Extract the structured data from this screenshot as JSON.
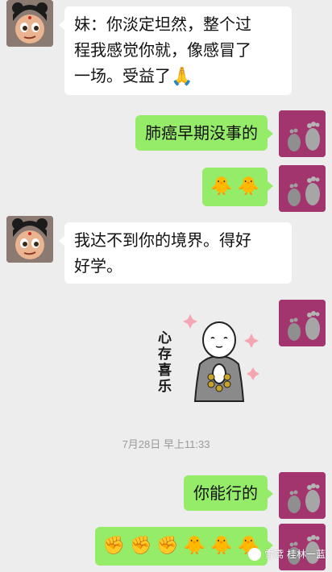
{
  "messages": [
    {
      "id": 1,
      "side": "in",
      "text_line1": "妹：你淡定坦然，整个过",
      "text_line2": "程我感觉你就，像感冒了",
      "text_line3": "一场。受益了",
      "emoji": "🙏"
    },
    {
      "id": 2,
      "side": "out",
      "text": "肺癌早期没事的"
    },
    {
      "id": 3,
      "side": "out",
      "emojis": [
        "🐥",
        "🐥"
      ]
    },
    {
      "id": 4,
      "side": "in",
      "text_line1": "我达不到你的境界。得好",
      "text_line2": "好学。"
    },
    {
      "id": 5,
      "side": "out",
      "sticker_text": "心存喜乐"
    },
    {
      "id": 6,
      "side": "out",
      "text": "你能行的"
    },
    {
      "id": 7,
      "side": "out",
      "emojis": [
        "✊",
        "✊",
        "✊",
        "🐥",
        "🐥",
        "🐥"
      ]
    }
  ],
  "timestamp": "7月28日 早上11:33",
  "watermark": "雪鸢 桂林一蓝",
  "colors": {
    "background": "#ededed",
    "incoming_bubble": "#ffffff",
    "outgoing_bubble": "#95ec69",
    "timestamp_text": "#9a9a9a"
  },
  "icons": {
    "contact_avatar": "girl-cartoon-avatar",
    "self_avatar": "footprints-avatar",
    "sticker": "monk-praying-sticker",
    "watermark_icon": "wechat-logo"
  }
}
